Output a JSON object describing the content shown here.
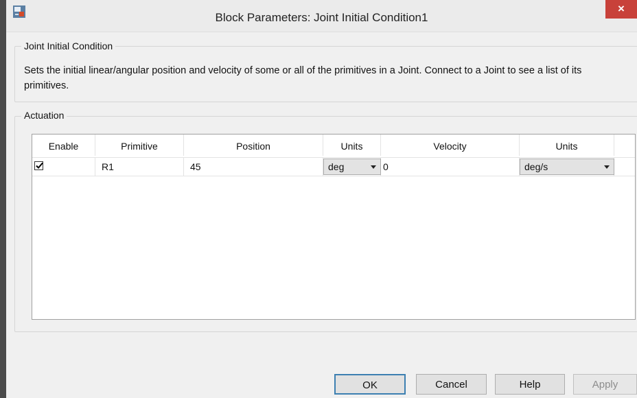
{
  "window": {
    "title": "Block Parameters: Joint Initial Condition1",
    "close_label": "×"
  },
  "description_group": {
    "legend": "Joint Initial Condition",
    "text": "Sets the initial linear/angular position and velocity of some or all of the primitives in a Joint. Connect to a Joint to see a list of its primitives."
  },
  "actuation": {
    "legend": "Actuation",
    "columns": [
      "Enable",
      "Primitive",
      "Position",
      "Units",
      "Velocity",
      "Units"
    ],
    "rows": [
      {
        "enabled": true,
        "primitive": "R1",
        "position": "45",
        "position_units": "deg",
        "velocity": "0",
        "velocity_units": "deg/s"
      }
    ]
  },
  "buttons": {
    "ok": "OK",
    "cancel": "Cancel",
    "help": "Help",
    "apply": "Apply"
  },
  "colors": {
    "close_button": "#c8413a",
    "default_button_border": "#3c7fb1"
  }
}
